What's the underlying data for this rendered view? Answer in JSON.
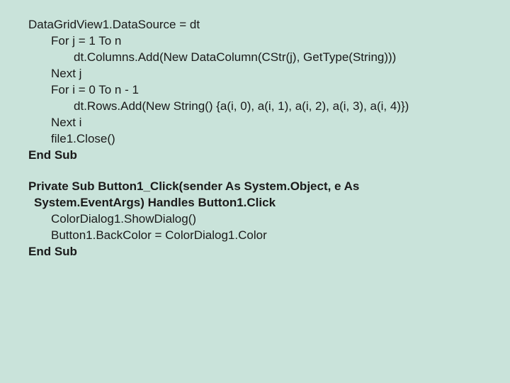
{
  "code": {
    "line1": "DataGridView1.DataSource = dt",
    "line2": "For j = 1 To n",
    "line3": "dt.Columns.Add(New DataColumn(CStr(j), GetType(String)))",
    "line4": "Next j",
    "line5": "For i = 0 To n - 1",
    "line6": "dt.Rows.Add(New String() {a(i, 0), a(i, 1), a(i, 2), a(i, 3), a(i, 4)})",
    "line7": "Next i",
    "line8": "file1.Close()",
    "line9": "End Sub",
    "line10a": "Private Sub Button1_Click(sender As System.Object, e As",
    "line10b": "System.EventArgs) Handles Button1.Click",
    "line11": "ColorDialog1.ShowDialog()",
    "line12": "Button1.BackColor = ColorDialog1.Color",
    "line13": "End Sub"
  }
}
